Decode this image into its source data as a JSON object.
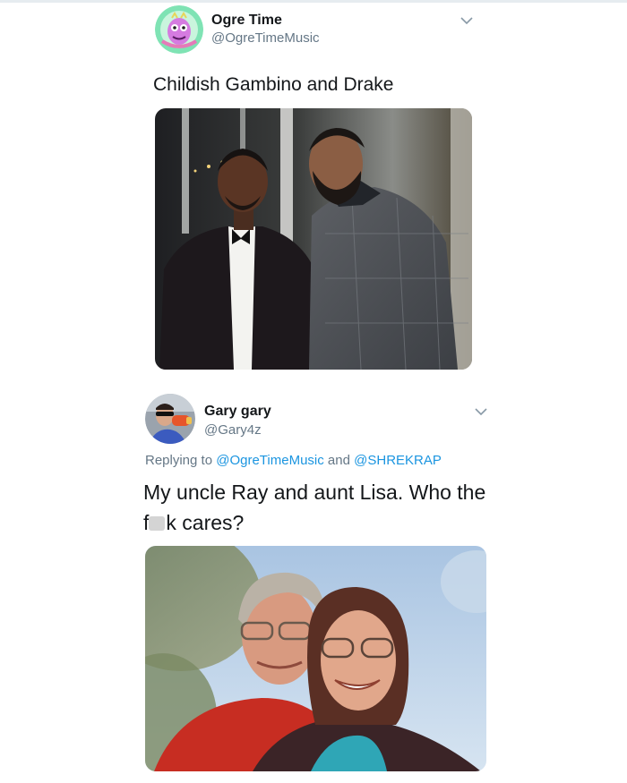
{
  "tweets": [
    {
      "author_name": "Ogre Time",
      "author_handle": "@OgreTimeMusic",
      "text": "Childish Gambino and Drake",
      "media_description": "photo",
      "avatar_icon": "ogre-avatar-icon"
    },
    {
      "author_name": "Gary gary",
      "author_handle": "@Gary4z",
      "reply_prefix": "Replying to",
      "reply_mentions": [
        "@OgreTimeMusic",
        "@SHREKRAP"
      ],
      "reply_joiner": "and",
      "text_part1": "My uncle Ray and aunt Lisa. Who the",
      "text_part2_prefix": "f",
      "text_part2_suffix": "k cares?",
      "avatar_icon": "user-avatar-icon"
    }
  ],
  "colors": {
    "accent": "#1b95e0",
    "secondary_text": "#657786",
    "primary_text": "#14171a"
  }
}
